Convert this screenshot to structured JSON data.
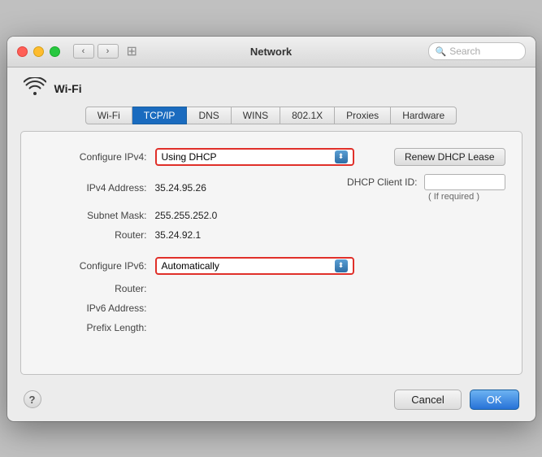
{
  "window": {
    "title": "Network",
    "search_placeholder": "Search"
  },
  "wifi": {
    "label": "Wi-Fi"
  },
  "tabs": [
    {
      "id": "wifi",
      "label": "Wi-Fi",
      "active": false
    },
    {
      "id": "tcpip",
      "label": "TCP/IP",
      "active": true
    },
    {
      "id": "dns",
      "label": "DNS",
      "active": false
    },
    {
      "id": "wins",
      "label": "WINS",
      "active": false
    },
    {
      "id": "8021x",
      "label": "802.1X",
      "active": false
    },
    {
      "id": "proxies",
      "label": "Proxies",
      "active": false
    },
    {
      "id": "hardware",
      "label": "Hardware",
      "active": false
    }
  ],
  "form": {
    "configure_ipv4_label": "Configure IPv4:",
    "configure_ipv4_value": "Using DHCP",
    "ipv4_address_label": "IPv4 Address:",
    "ipv4_address_value": "35.24.95.26",
    "subnet_mask_label": "Subnet Mask:",
    "subnet_mask_value": "255.255.252.0",
    "router_label": "Router:",
    "router_value": "35.24.92.1",
    "dhcp_client_label": "DHCP Client ID:",
    "if_required": "( If required )",
    "renew_dhcp_label": "Renew DHCP Lease",
    "configure_ipv6_label": "Configure IPv6:",
    "configure_ipv6_value": "Automatically",
    "router6_label": "Router:",
    "ipv6_address_label": "IPv6 Address:",
    "prefix_length_label": "Prefix Length:"
  },
  "buttons": {
    "help": "?",
    "cancel": "Cancel",
    "ok": "OK"
  }
}
